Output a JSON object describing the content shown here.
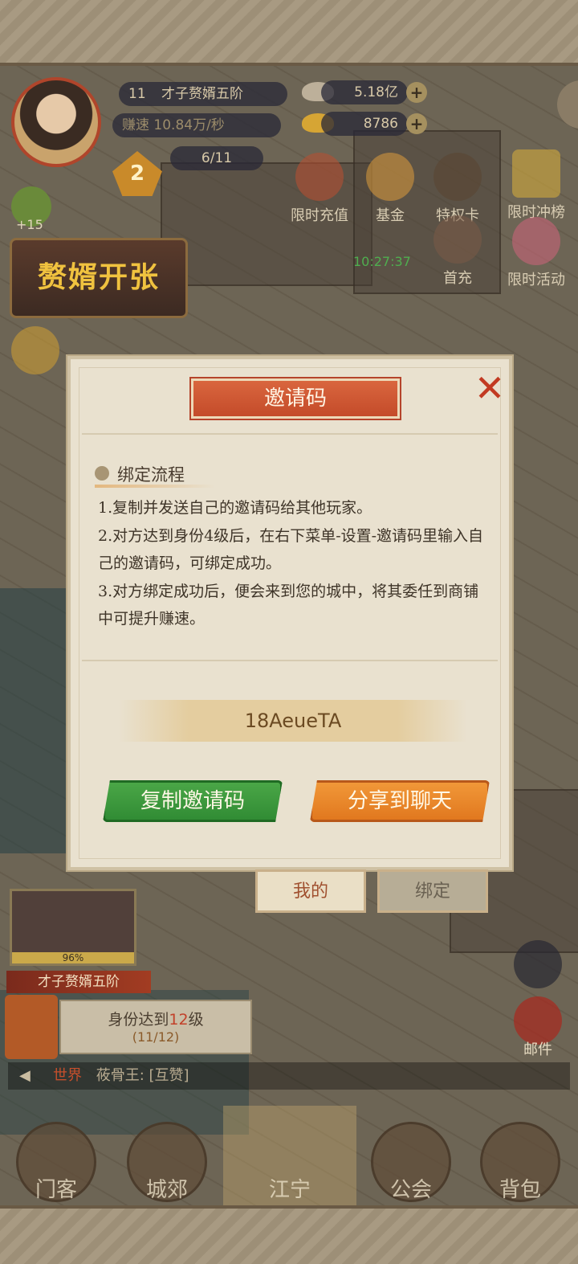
{
  "player": {
    "level": "11",
    "title": "才子赘婿五阶",
    "earn_label": "赚速",
    "earn_value": "10.84万/秒",
    "silver": "5.18亿",
    "gold": "8786",
    "stamina": "6/11",
    "vip": "2",
    "like": "+15"
  },
  "features": [
    "限时充值",
    "基金",
    "特权卡",
    "限时冲榜",
    "首充",
    "限时活动"
  ],
  "timer": "10:27:37",
  "banner": "赘婿开张",
  "dialog": {
    "title": "邀请码",
    "section_label": "绑定流程",
    "steps": [
      "1.复制并发送自己的邀请码给其他玩家。",
      "2.对方达到身份4级后，在右下菜单-设置-邀请码里输入自己的邀请码，可绑定成功。",
      "3.对方绑定成功后，便会来到您的城中，将其委任到商铺中可提升赚速。"
    ],
    "invite_code": "18AeueTA",
    "copy_button": "复制邀请码",
    "share_button": "分享到聊天"
  },
  "tabs": [
    "我的",
    "绑定"
  ],
  "portrait_percent": "96%",
  "rank_title": "才子赘婿五阶",
  "quest": {
    "line1_prefix": "身份达到",
    "line1_level": "12",
    "line1_suffix": "级",
    "progress": "(11/12)"
  },
  "mail_label": "邮件",
  "chat": {
    "channel": "世界",
    "message": "莜骨王: [互赞]"
  },
  "nav": [
    "门客",
    "城郊",
    "江宁",
    "公会",
    "背包"
  ],
  "colors": {
    "accent_red": "#c44b2a",
    "green": "#2f8a33",
    "orange": "#e0761d",
    "paper": "#e9e1cf"
  }
}
